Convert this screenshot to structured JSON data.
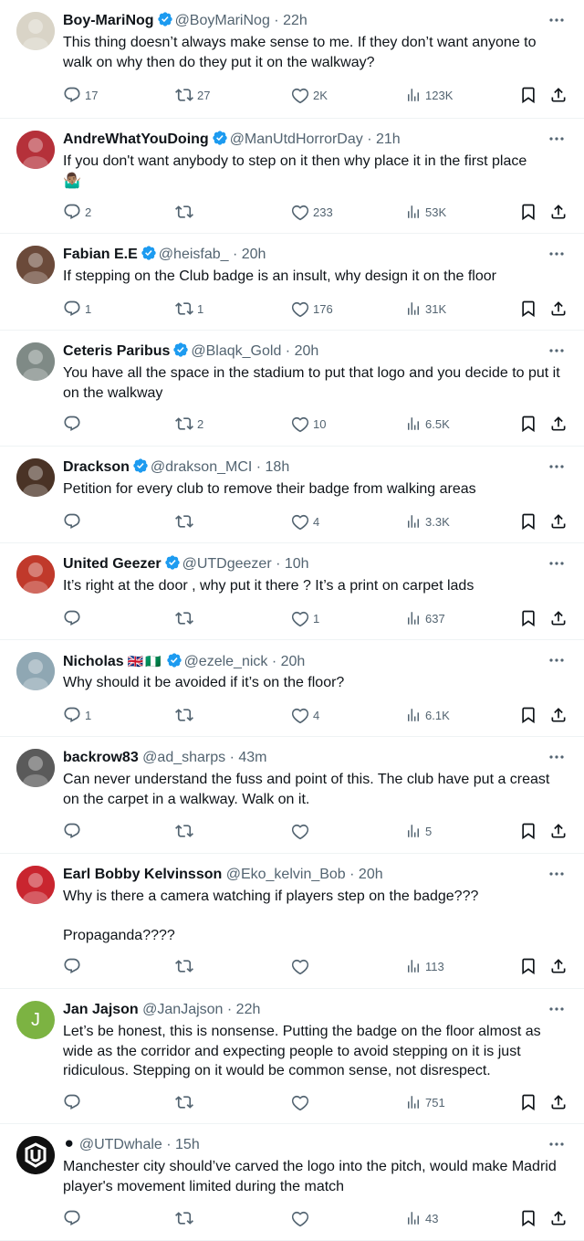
{
  "tweets": [
    {
      "name": "Boy-MariNog",
      "verified": true,
      "handle": "@BoyMariNog",
      "time": "22h",
      "text": "This thing doesn’t always make sense to me. If they don’t want anyone to walk on why then do they put it on the walkway?",
      "replies": "17",
      "retweets": "27",
      "likes": "2K",
      "views": "123K",
      "avatar_color": "#d9d4c7"
    },
    {
      "name": "AndreWhatYouDoing",
      "verified": true,
      "handle": "@ManUtdHorrorDay",
      "time": "21h",
      "text": "If you don't want anybody to step on it then why place it in the first place",
      "emoji": "🤷🏽‍♂️",
      "replies": "2",
      "retweets": "",
      "likes": "233",
      "views": "53K",
      "avatar_color": "#b5313a"
    },
    {
      "name": "Fabian E.E",
      "verified": true,
      "handle": "@heisfab_",
      "time": "20h",
      "text": "If stepping on the Club badge is an insult, why design it on the floor",
      "replies": "1",
      "retweets": "1",
      "likes": "176",
      "views": "31K",
      "avatar_color": "#6b4a3a"
    },
    {
      "name": "Ceteris Paribus",
      "verified": true,
      "handle": "@Blaqk_Gold",
      "time": "20h",
      "text": "You have all the space in the stadium to put that logo and you decide to put it on the walkway",
      "replies": "",
      "retweets": "2",
      "likes": "10",
      "views": "6.5K",
      "avatar_color": "#7f8a86"
    },
    {
      "name": "Drackson",
      "verified": true,
      "handle": "@drakson_MCI",
      "time": "18h",
      "text": "Petition for every club to remove their badge from walking areas",
      "replies": "",
      "retweets": "",
      "likes": "4",
      "views": "3.3K",
      "avatar_color": "#4a3326"
    },
    {
      "name": "United Geezer",
      "verified": true,
      "handle": "@UTDgeezer",
      "time": "10h",
      "text": "It’s right at the door , why put it there ? It’s a print on carpet lads",
      "replies": "",
      "retweets": "",
      "likes": "1",
      "views": "637",
      "avatar_color": "#c0392b"
    },
    {
      "name": "Nicholas",
      "flags": "🇬🇧🇳🇬",
      "verified": true,
      "handle": "@ezele_nick",
      "time": "20h",
      "text": "Why should it be avoided if it’s on the floor?",
      "replies": "1",
      "retweets": "",
      "likes": "4",
      "views": "6.1K",
      "avatar_color": "#8fa7b3"
    },
    {
      "name": "backrow83",
      "verified": false,
      "handle": "@ad_sharps",
      "time": "43m",
      "text": "Can never understand the fuss and point of this. The club have put a creast on the carpet in a walkway. Walk on it.",
      "replies": "",
      "retweets": "",
      "likes": "",
      "views": "5",
      "avatar_color": "#5a5a5a"
    },
    {
      "name": "Earl Bobby Kelvinsson",
      "verified": false,
      "handle": "@Eko_kelvin_Bob",
      "time": "20h",
      "text": "Why is there a camera watching if players step on the badge???\n\nPropaganda????",
      "replies": "",
      "retweets": "",
      "likes": "",
      "views": "113",
      "avatar_color": "#c9252f"
    },
    {
      "name": "Jan Jajson",
      "verified": false,
      "handle": "@JanJajson",
      "time": "22h",
      "text": "Let’s be honest, this is nonsense. Putting the badge on the floor almost as wide as the corridor and expecting people to avoid stepping on it is just ridiculous. Stepping on it would be common sense, not disrespect.",
      "avatar_letter": "J",
      "replies": "",
      "retweets": "",
      "likes": "",
      "views": "751",
      "avatar_color": "#7cb342"
    },
    {
      "name": "⚫",
      "verified": false,
      "handle": "@UTDwhale",
      "time": "15h",
      "text": "Manchester city should’ve carved the logo into the pitch, would make Madrid player's movement limited during the match",
      "replies": "",
      "retweets": "",
      "likes": "",
      "views": "43",
      "avatar_color": "#111111"
    }
  ],
  "colors": {
    "text": "#0f1419",
    "secondary": "#536471",
    "verified": "#1d9bf0",
    "divider": "#eff3f4"
  },
  "icons": {
    "reply": "reply-icon",
    "retweet": "retweet-icon",
    "like": "heart-icon",
    "views": "views-icon",
    "bookmark": "bookmark-icon",
    "share": "share-icon",
    "more": "more-icon",
    "verified": "verified-badge-icon"
  }
}
